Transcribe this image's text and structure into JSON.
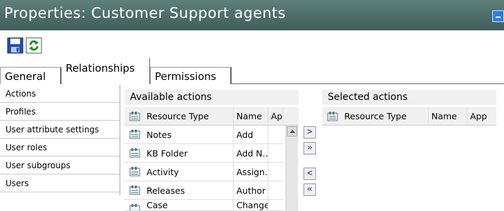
{
  "window": {
    "title": "Properties: Customer Support agents"
  },
  "toolbar": {
    "save_icon": "save-icon",
    "refresh_icon": "refresh-icon"
  },
  "tabs": [
    {
      "label": "General"
    },
    {
      "label": "Relationships",
      "active": true
    },
    {
      "label": "Permissions"
    }
  ],
  "nav": {
    "items": [
      {
        "label": "Actions"
      },
      {
        "label": "Profiles"
      },
      {
        "label": "User attribute settings"
      },
      {
        "label": "User roles"
      },
      {
        "label": "User subgroups"
      },
      {
        "label": "Users"
      }
    ]
  },
  "available": {
    "heading": "Available actions",
    "columns": {
      "type": "Resource Type",
      "name": "Name",
      "app": "App"
    },
    "rows": [
      {
        "type": "Notes",
        "name": "Add"
      },
      {
        "type": "KB Folder",
        "name": "Add N…"
      },
      {
        "type": "Activity",
        "name": "Assign…"
      },
      {
        "type": "Releases",
        "name": "Author"
      },
      {
        "type": "Case",
        "name": "Change"
      }
    ]
  },
  "selected": {
    "heading": "Selected actions",
    "columns": {
      "type": "Resource Type",
      "name": "Name",
      "app": "App"
    }
  },
  "buttons": {
    "add": ">",
    "add_all": "»",
    "remove": "<",
    "remove_all": "«"
  }
}
